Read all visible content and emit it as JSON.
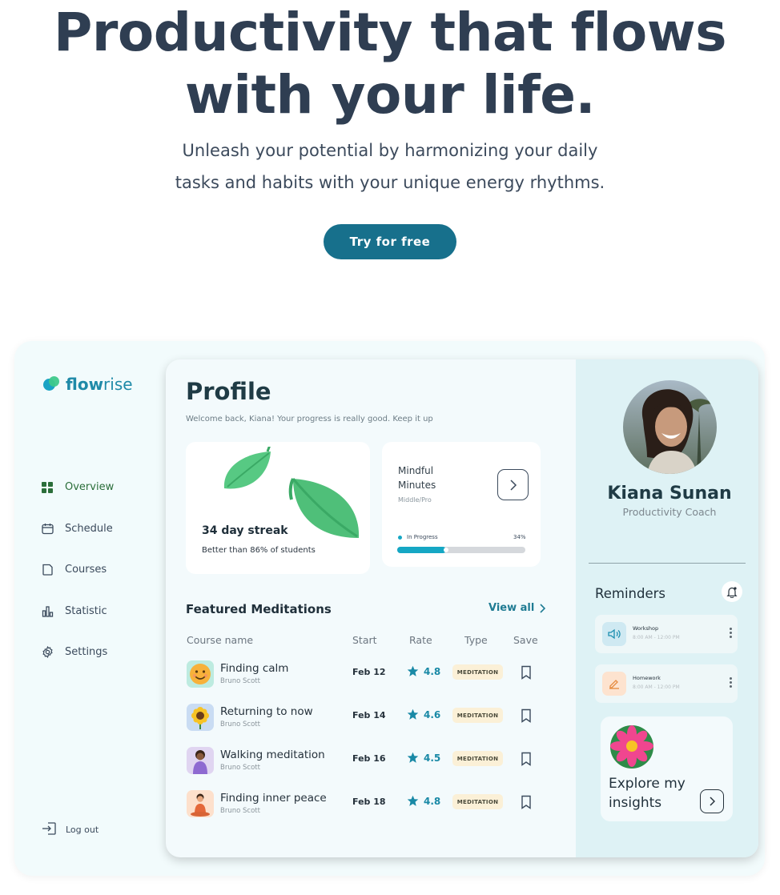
{
  "hero": {
    "title_line1": "Productivity that flows",
    "title_line2": "with your life.",
    "subtitle_line1": "Unleash your potential by harmonizing your daily",
    "subtitle_line2": "tasks and habits with your unique energy rhythms.",
    "cta_label": "Try for free"
  },
  "brand": {
    "logo_text_bold": "flow",
    "logo_text_rest": "rise"
  },
  "sidebar": {
    "items": [
      {
        "label": "Overview",
        "icon": "grid-icon",
        "active": true
      },
      {
        "label": "Schedule",
        "icon": "calendar-icon",
        "active": false
      },
      {
        "label": "Courses",
        "icon": "folder-icon",
        "active": false
      },
      {
        "label": "Statistic",
        "icon": "bar-chart-icon",
        "active": false
      },
      {
        "label": "Settings",
        "icon": "gear-icon",
        "active": false
      }
    ],
    "logout_label": "Log out"
  },
  "profile": {
    "title": "Profile",
    "welcome": "Welcome back, Kiana! Your progress is really good. Keep it up"
  },
  "streak": {
    "title": "34 day streak",
    "subtitle": "Better than 86% of students"
  },
  "mindful": {
    "title": "Mindful Minutes",
    "level": "Middle/Pro",
    "status": "In Progress",
    "progress_label": "34%",
    "progress": 0.38
  },
  "featured": {
    "title": "Featured Meditations",
    "view_all": "View all",
    "columns": [
      "Course name",
      "Start",
      "Rate",
      "Type",
      "Save"
    ],
    "rows": [
      {
        "name": "Finding calm",
        "author": "Bruno Scott",
        "start": "Feb 12",
        "rate": "4.8",
        "type": "MEDITATION",
        "avatar": "smiley"
      },
      {
        "name": "Returning to now",
        "author": "Bruno Scott",
        "start": "Feb 14",
        "rate": "4.6",
        "type": "MEDITATION",
        "avatar": "sunflower"
      },
      {
        "name": "Walking meditation",
        "author": "Bruno Scott",
        "start": "Feb 16",
        "rate": "4.5",
        "type": "MEDITATION",
        "avatar": "person-purple"
      },
      {
        "name": "Finding inner peace",
        "author": "Bruno Scott",
        "start": "Feb 18",
        "rate": "4.8",
        "type": "MEDITATION",
        "avatar": "person-orange"
      }
    ]
  },
  "user": {
    "name": "Kiana Sunan",
    "role": "Productivity Coach"
  },
  "reminders": {
    "title": "Reminders",
    "items": [
      {
        "name": "Workshop",
        "time": "8:00 AM - 12:00 PM",
        "icon": "speaker-icon",
        "color": "#cfe9f2"
      },
      {
        "name": "Homework",
        "time": "8:00 AM - 12:00 PM",
        "icon": "pencil-icon",
        "color": "#fde3cf"
      }
    ]
  },
  "insights": {
    "label": "Explore my insights"
  },
  "colors": {
    "accent": "#17708c",
    "teal": "#15a7c4",
    "leaf": "#4fc47c",
    "right_panel": "#def2f5"
  }
}
